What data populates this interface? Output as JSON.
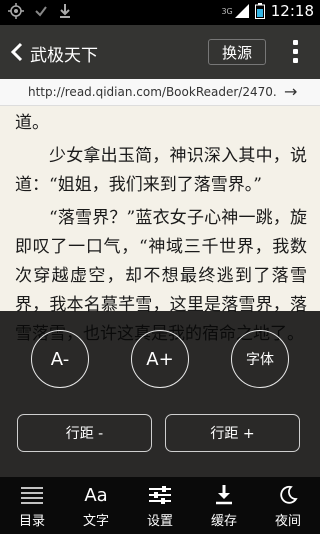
{
  "status_bar": {
    "time": "12:18",
    "network": "3G"
  },
  "header": {
    "title": "武极天下",
    "switch_source": "换源"
  },
  "url_bar": {
    "url": "http://read.qidian.com/BookReader/2470."
  },
  "content": {
    "paragraphs": [
      "道。",
      "少女拿出玉简，神识深入其中，说道：“姐姐，我们来到了落雪界。”",
      "“落雪界？”蓝衣女子心神一跳，旋即叹了一口气，“神域三千世界，我数次穿越虚空，却不想最终逃到了落雪界，我本名慕芊雪，这里是落雪界，落雪落雪，也许这真是我的宿命之地了。"
    ]
  },
  "settings": {
    "font_decrease": "A-",
    "font_increase": "A+",
    "font_face": "字体",
    "line_spacing_decrease": "行距 -",
    "line_spacing_increase": "行距 +"
  },
  "bottom_nav": [
    {
      "label": "目录",
      "icon": "list-icon"
    },
    {
      "label": "文字",
      "icon": "text-size-icon",
      "glyph": "Aa"
    },
    {
      "label": "设置",
      "icon": "sliders-icon"
    },
    {
      "label": "缓存",
      "icon": "download-icon"
    },
    {
      "label": "夜间",
      "icon": "moon-icon"
    }
  ]
}
